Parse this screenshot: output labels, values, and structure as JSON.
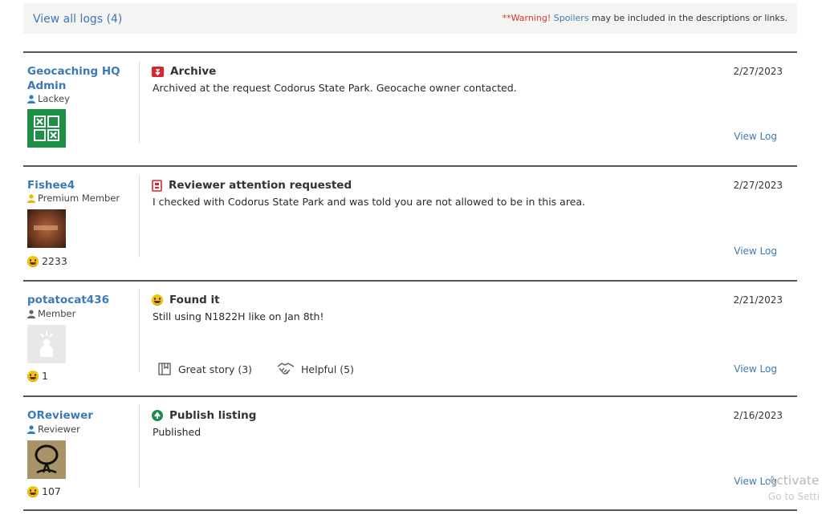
{
  "header": {
    "view_all": "View all logs (4)",
    "warning_prefix": "**Warning!",
    "warning_link": "Spoilers",
    "warning_suffix": "may be included in the descriptions or links."
  },
  "logs": [
    {
      "user": "Geocaching HQ Admin",
      "role": "Lackey",
      "log_type": "Archive",
      "text": "Archived at the request Codorus State Park. Geocache owner contacted.",
      "date": "2/27/2023",
      "view_log": "View Log",
      "type_icon": "archive-icon"
    },
    {
      "user": "Fishee4",
      "role": "Premium Member",
      "finds": "2233",
      "log_type": "Reviewer attention requested",
      "text": "I checked with Codorus State Park and was told you are not allowed to be in this area.",
      "date": "2/27/2023",
      "view_log": "View Log",
      "type_icon": "reviewer-attention-icon"
    },
    {
      "user": "potatocat436",
      "role": "Member",
      "finds": "1",
      "log_type": "Found it",
      "text": "Still using N1822H like on Jan 8th!",
      "date": "2/21/2023",
      "view_log": "View Log",
      "type_icon": "found-it-icon",
      "reactions": {
        "great_story": "Great story (3)",
        "helpful": "Helpful (5)"
      }
    },
    {
      "user": "OReviewer",
      "role": "Reviewer",
      "finds": "107",
      "log_type": "Publish listing",
      "text": "Published",
      "date": "2/16/2023",
      "view_log": "View Log",
      "type_icon": "publish-icon"
    }
  ],
  "watermark": {
    "line1": "Activate",
    "line2": "Go to Setti"
  },
  "colors": {
    "link": "#3b7ab5",
    "warning": "#d33a2c",
    "archive": "#d9252f",
    "publish": "#1f8a4c"
  }
}
